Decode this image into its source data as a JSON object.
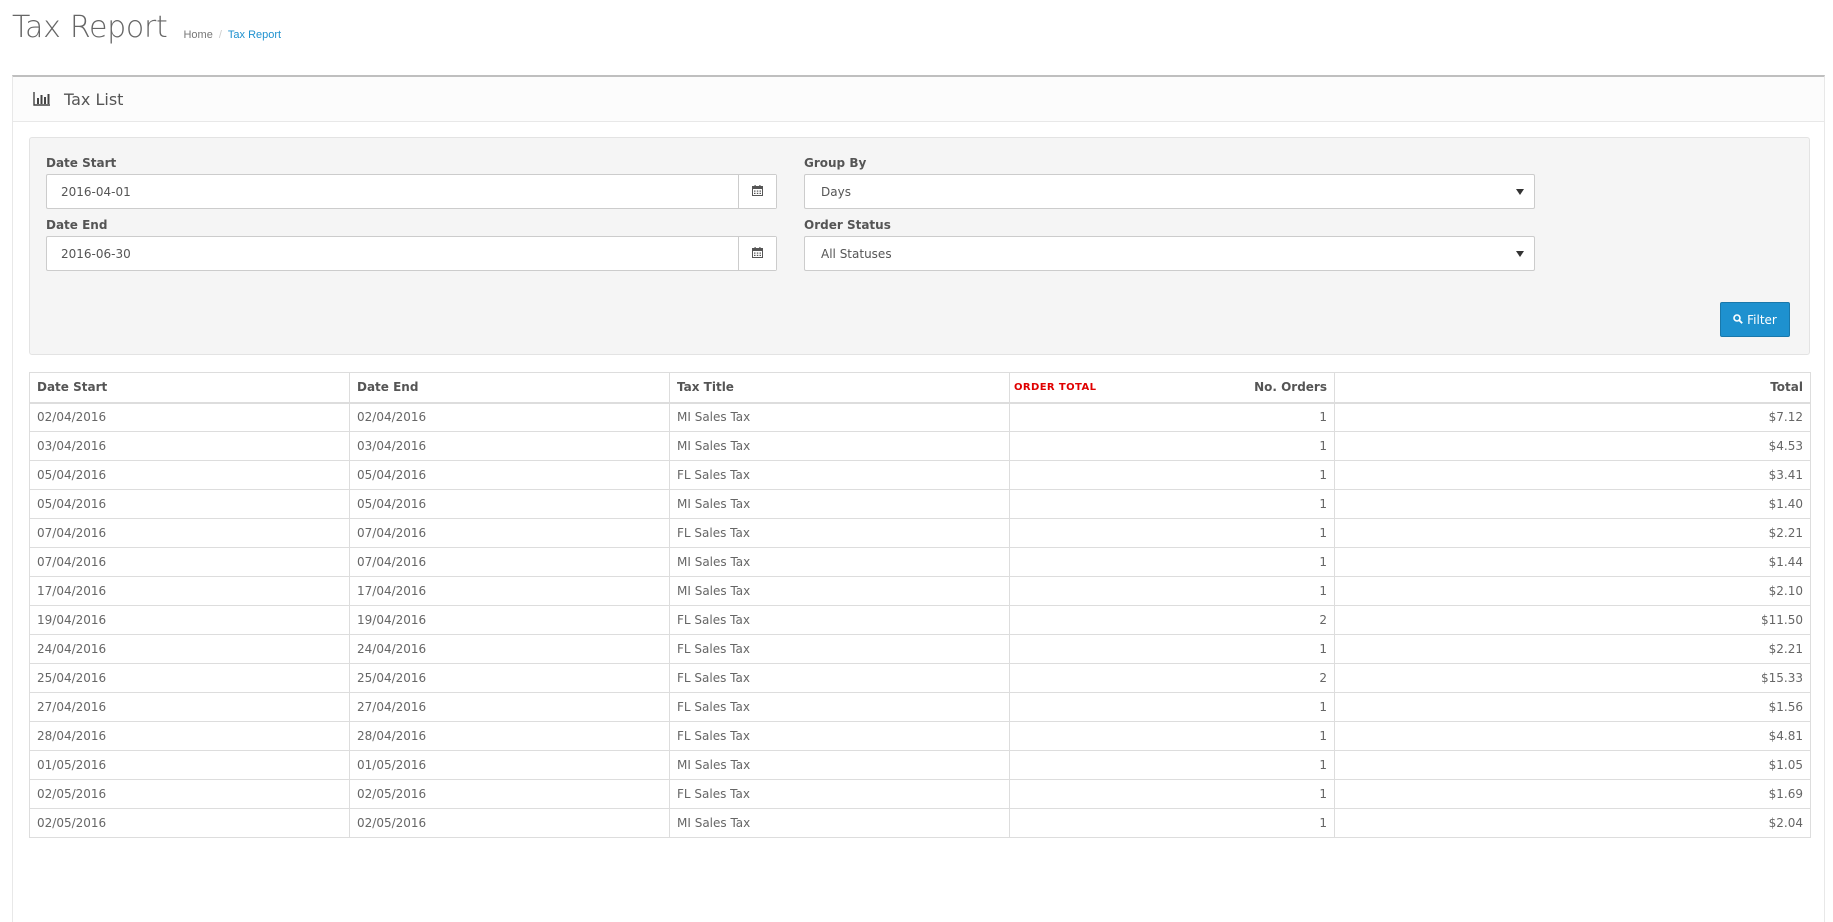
{
  "page": {
    "title": "Tax Report",
    "breadcrumb": [
      {
        "label": "Home"
      },
      {
        "label": "Tax Report"
      }
    ],
    "breadcrumb_separator": "/"
  },
  "panel": {
    "title": "Tax List",
    "icon": "bar-chart-icon"
  },
  "filters": {
    "date_start": {
      "label": "Date Start",
      "value": "2016-04-01",
      "icon": "calendar-icon"
    },
    "date_end": {
      "label": "Date End",
      "value": "2016-06-30",
      "icon": "calendar-icon"
    },
    "group_by": {
      "label": "Group By",
      "value": "Days"
    },
    "order_status": {
      "label": "Order Status",
      "value": "All Statuses"
    },
    "filter_button": {
      "label": "Filter",
      "icon": "search-icon"
    }
  },
  "table": {
    "columns": [
      "Date Start",
      "Date End",
      "Tax Title",
      "No. Orders",
      "Total"
    ],
    "annotation": "ORDER TOTAL",
    "rows": [
      {
        "date_start": "02/04/2016",
        "date_end": "02/04/2016",
        "tax_title": "MI Sales Tax",
        "orders": "1",
        "total": "$7.12"
      },
      {
        "date_start": "03/04/2016",
        "date_end": "03/04/2016",
        "tax_title": "MI Sales Tax",
        "orders": "1",
        "total": "$4.53"
      },
      {
        "date_start": "05/04/2016",
        "date_end": "05/04/2016",
        "tax_title": "FL Sales Tax",
        "orders": "1",
        "total": "$3.41"
      },
      {
        "date_start": "05/04/2016",
        "date_end": "05/04/2016",
        "tax_title": "MI Sales Tax",
        "orders": "1",
        "total": "$1.40"
      },
      {
        "date_start": "07/04/2016",
        "date_end": "07/04/2016",
        "tax_title": "FL Sales Tax",
        "orders": "1",
        "total": "$2.21"
      },
      {
        "date_start": "07/04/2016",
        "date_end": "07/04/2016",
        "tax_title": "MI Sales Tax",
        "orders": "1",
        "total": "$1.44"
      },
      {
        "date_start": "17/04/2016",
        "date_end": "17/04/2016",
        "tax_title": "MI Sales Tax",
        "orders": "1",
        "total": "$2.10"
      },
      {
        "date_start": "19/04/2016",
        "date_end": "19/04/2016",
        "tax_title": "FL Sales Tax",
        "orders": "2",
        "total": "$11.50"
      },
      {
        "date_start": "24/04/2016",
        "date_end": "24/04/2016",
        "tax_title": "FL Sales Tax",
        "orders": "1",
        "total": "$2.21"
      },
      {
        "date_start": "25/04/2016",
        "date_end": "25/04/2016",
        "tax_title": "FL Sales Tax",
        "orders": "2",
        "total": "$15.33"
      },
      {
        "date_start": "27/04/2016",
        "date_end": "27/04/2016",
        "tax_title": "FL Sales Tax",
        "orders": "1",
        "total": "$1.56"
      },
      {
        "date_start": "28/04/2016",
        "date_end": "28/04/2016",
        "tax_title": "FL Sales Tax",
        "orders": "1",
        "total": "$4.81"
      },
      {
        "date_start": "01/05/2016",
        "date_end": "01/05/2016",
        "tax_title": "MI Sales Tax",
        "orders": "1",
        "total": "$1.05"
      },
      {
        "date_start": "02/05/2016",
        "date_end": "02/05/2016",
        "tax_title": "FL Sales Tax",
        "orders": "1",
        "total": "$1.69"
      },
      {
        "date_start": "02/05/2016",
        "date_end": "02/05/2016",
        "tax_title": "MI Sales Tax",
        "orders": "1",
        "total": "$2.04"
      }
    ]
  },
  "colors": {
    "accent": "#1e91cf",
    "annotation": "#e00000"
  }
}
